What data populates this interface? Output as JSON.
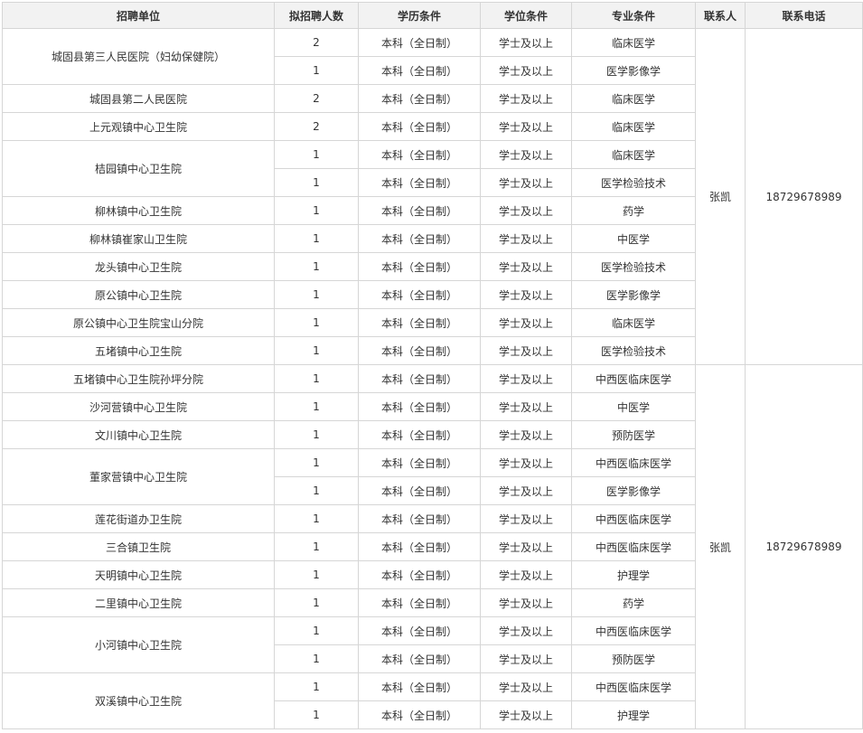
{
  "headers": [
    "招聘单位",
    "拟招聘人数",
    "学历条件",
    "学位条件",
    "专业条件",
    "联系人",
    "联系电话"
  ],
  "rows": [
    [
      "城固县第三人民医院（妇幼保健院）",
      "2",
      "本科（全日制）",
      "学士及以上",
      "临床医学"
    ],
    [
      "",
      "1",
      "本科（全日制）",
      "学士及以上",
      "医学影像学"
    ],
    [
      "城固县第二人民医院",
      "2",
      "本科（全日制）",
      "学士及以上",
      "临床医学"
    ],
    [
      "上元观镇中心卫生院",
      "2",
      "本科（全日制）",
      "学士及以上",
      "临床医学"
    ],
    [
      "桔园镇中心卫生院",
      "1",
      "本科（全日制）",
      "学士及以上",
      "临床医学"
    ],
    [
      "",
      "1",
      "本科（全日制）",
      "学士及以上",
      "医学检验技术"
    ],
    [
      "柳林镇中心卫生院",
      "1",
      "本科（全日制）",
      "学士及以上",
      "药学"
    ],
    [
      "柳林镇崔家山卫生院",
      "1",
      "本科（全日制）",
      "学士及以上",
      "中医学"
    ],
    [
      "龙头镇中心卫生院",
      "1",
      "本科（全日制）",
      "学士及以上",
      "医学检验技术"
    ],
    [
      "原公镇中心卫生院",
      "1",
      "本科（全日制）",
      "学士及以上",
      "医学影像学"
    ],
    [
      "原公镇中心卫生院宝山分院",
      "1",
      "本科（全日制）",
      "学士及以上",
      "临床医学"
    ],
    [
      "五堵镇中心卫生院",
      "1",
      "本科（全日制）",
      "学士及以上",
      "医学检验技术"
    ],
    [
      "五堵镇中心卫生院孙坪分院",
      "1",
      "本科（全日制）",
      "学士及以上",
      "中西医临床医学"
    ],
    [
      "沙河营镇中心卫生院",
      "1",
      "本科（全日制）",
      "学士及以上",
      "中医学"
    ],
    [
      "文川镇中心卫生院",
      "1",
      "本科（全日制）",
      "学士及以上",
      "预防医学"
    ],
    [
      "董家营镇中心卫生院",
      "1",
      "本科（全日制）",
      "学士及以上",
      "中西医临床医学"
    ],
    [
      "",
      "1",
      "本科（全日制）",
      "学士及以上",
      "医学影像学"
    ],
    [
      "莲花街道办卫生院",
      "1",
      "本科（全日制）",
      "学士及以上",
      "中西医临床医学"
    ],
    [
      "三合镇卫生院",
      "1",
      "本科（全日制）",
      "学士及以上",
      "中西医临床医学"
    ],
    [
      "天明镇中心卫生院",
      "1",
      "本科（全日制）",
      "学士及以上",
      "护理学"
    ],
    [
      "二里镇中心卫生院",
      "1",
      "本科（全日制）",
      "学士及以上",
      "药学"
    ],
    [
      "小河镇中心卫生院",
      "1",
      "本科（全日制）",
      "学士及以上",
      "中西医临床医学"
    ],
    [
      "",
      "1",
      "本科（全日制）",
      "学士及以上",
      "预防医学"
    ],
    [
      "双溪镇中心卫生院",
      "1",
      "本科（全日制）",
      "学士及以上",
      "中西医临床医学"
    ],
    [
      "",
      "1",
      "本科（全日制）",
      "学士及以上",
      "护理学"
    ]
  ],
  "contacts": [
    {
      "name": "张凯",
      "phone": "18729678989"
    },
    {
      "name": "张凯",
      "phone": "18729678989"
    }
  ]
}
